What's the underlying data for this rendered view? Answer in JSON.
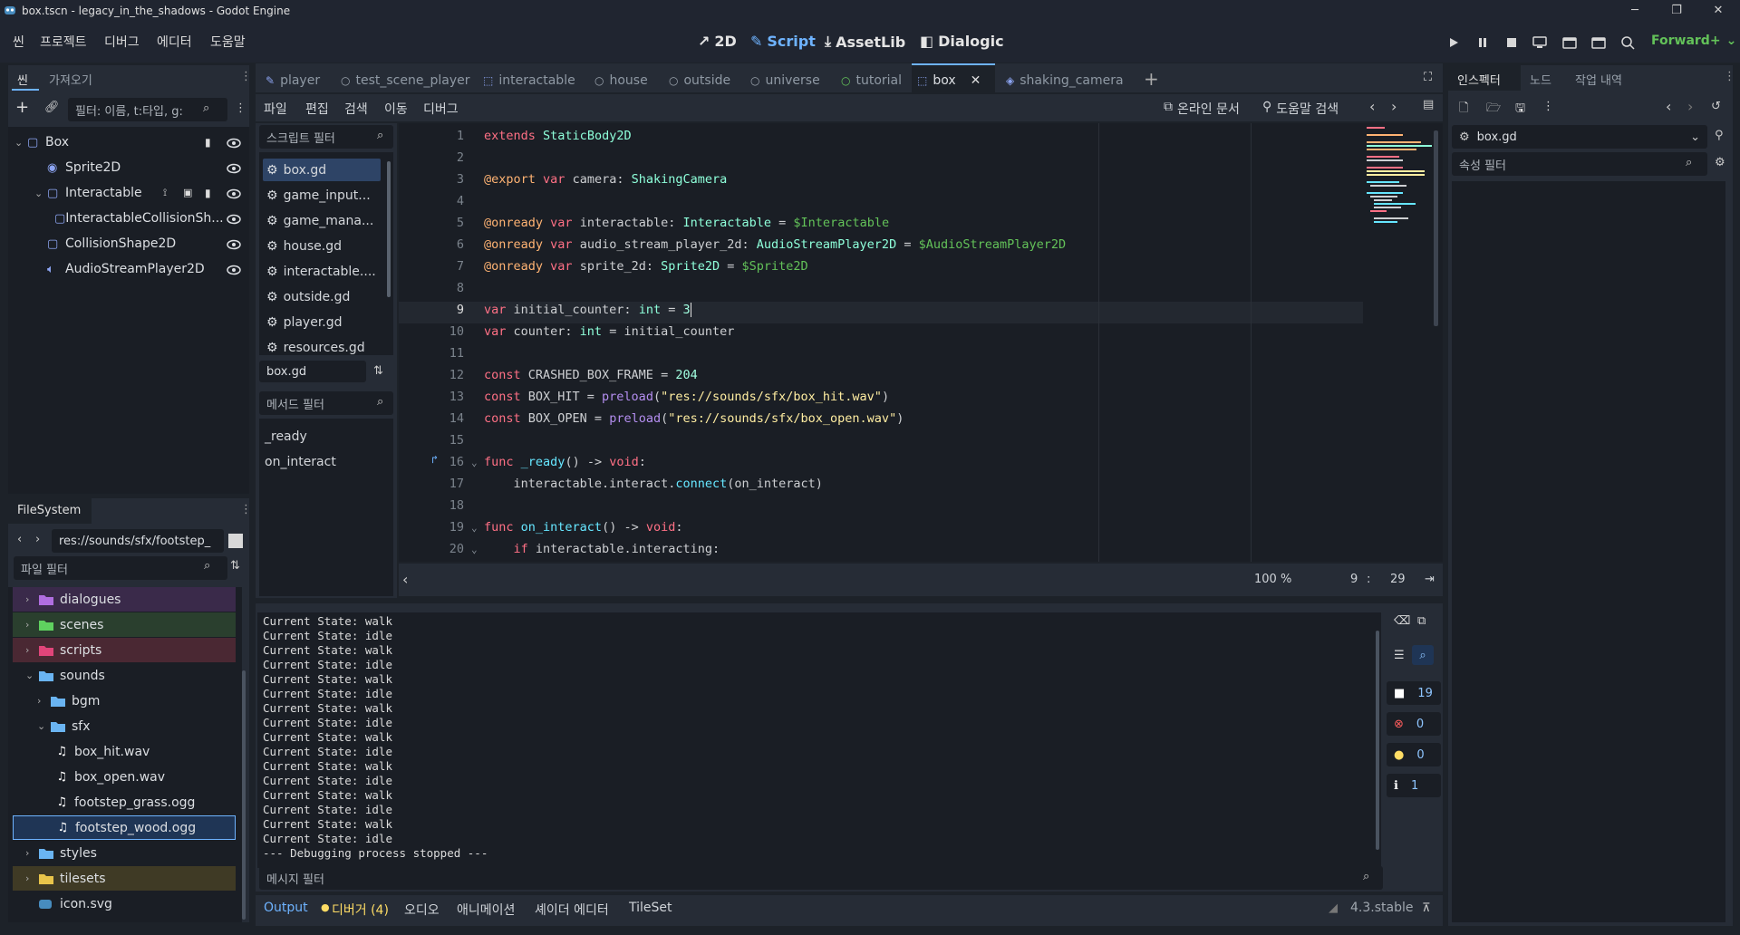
{
  "window": {
    "title": "box.tscn - legacy_in_the_shadows - Godot Engine"
  },
  "menu": [
    "씬",
    "프로젝트",
    "디버그",
    "에디터",
    "도움말"
  ],
  "workspaces": [
    {
      "label": "2D"
    },
    {
      "label": "Script",
      "active": true
    },
    {
      "label": "AssetLib"
    },
    {
      "label": "Dialogic"
    }
  ],
  "renderer": "Forward+",
  "scene_dock": {
    "tabs": [
      "씬",
      "가져오기"
    ],
    "filter_placeholder": "필터: 이름, t:타입, g:",
    "nodes": [
      {
        "name": "Box",
        "depth": 0,
        "icon": "static-body-icon"
      },
      {
        "name": "Sprite2D",
        "depth": 1,
        "icon": "sprite-icon"
      },
      {
        "name": "Interactable",
        "depth": 1,
        "icon": "area-icon"
      },
      {
        "name": "InteractableCollisionSh...",
        "depth": 2,
        "icon": "collision-icon"
      },
      {
        "name": "CollisionShape2D",
        "depth": 1,
        "icon": "collision-icon"
      },
      {
        "name": "AudioStreamPlayer2D",
        "depth": 1,
        "icon": "audio-icon"
      }
    ]
  },
  "filesystem": {
    "tab": "FileSystem",
    "path": "res://sounds/sfx/footstep_",
    "filter_placeholder": "파일 필터",
    "items": [
      {
        "name": "dialogues",
        "depth": 0,
        "type": "folder",
        "color": "#b06ee0",
        "bg": "#3a2a4a"
      },
      {
        "name": "scenes",
        "depth": 0,
        "type": "folder",
        "color": "#5fd15f",
        "bg": "#2a3f2e"
      },
      {
        "name": "scripts",
        "depth": 0,
        "type": "folder",
        "color": "#e0457a",
        "bg": "#4a2833"
      },
      {
        "name": "sounds",
        "depth": 0,
        "type": "folder",
        "color": "#6ab4f2",
        "bg": ""
      },
      {
        "name": "bgm",
        "depth": 1,
        "type": "folder",
        "color": "#6ab4f2",
        "bg": ""
      },
      {
        "name": "sfx",
        "depth": 1,
        "type": "folder",
        "color": "#6ab4f2",
        "bg": ""
      },
      {
        "name": "box_hit.wav",
        "depth": 2,
        "type": "audio",
        "bg": ""
      },
      {
        "name": "box_open.wav",
        "depth": 2,
        "type": "audio",
        "bg": ""
      },
      {
        "name": "footstep_grass.ogg",
        "depth": 2,
        "type": "audio",
        "bg": ""
      },
      {
        "name": "footstep_wood.ogg",
        "depth": 2,
        "type": "audio",
        "bg": "#1f3555",
        "selected": true
      },
      {
        "name": "styles",
        "depth": 0,
        "type": "folder",
        "color": "#6ab4f2",
        "bg": ""
      },
      {
        "name": "tilesets",
        "depth": 0,
        "type": "folder",
        "color": "#e8c44a",
        "bg": "#3f3a25"
      },
      {
        "name": "icon.svg",
        "depth": 0,
        "type": "image",
        "bg": ""
      }
    ]
  },
  "editor_tabs": [
    {
      "label": "player",
      "icon": "script-icon"
    },
    {
      "label": "test_scene_player",
      "icon": "node-icon"
    },
    {
      "label": "interactable",
      "icon": "area-icon"
    },
    {
      "label": "house",
      "icon": "node-icon"
    },
    {
      "label": "outside",
      "icon": "node-icon"
    },
    {
      "label": "universe",
      "icon": "node-icon"
    },
    {
      "label": "tutorial",
      "icon": "node-icon"
    },
    {
      "label": "box",
      "icon": "static-body-icon",
      "active": true
    },
    {
      "label": "shaking_camera",
      "icon": "camera-icon"
    }
  ],
  "script_menu": [
    "파일",
    "편집",
    "검색",
    "이동",
    "디버그"
  ],
  "online_docs": "온라인 문서",
  "help_search": "도움말 검색",
  "script_filter": "스크립트 필터",
  "scripts": [
    "box.gd",
    "game_input...",
    "game_mana...",
    "house.gd",
    "interactable....",
    "outside.gd",
    "player.gd",
    "resources.gd"
  ],
  "current_script": "box.gd",
  "method_filter": "메서드 필터",
  "methods": [
    "_ready",
    "on_interact"
  ],
  "code": [
    [
      [
        "kw",
        "extends"
      ],
      [
        "tx",
        " "
      ],
      [
        "ty",
        "StaticBody2D"
      ]
    ],
    [],
    [
      [
        "an",
        "@export"
      ],
      [
        "tx",
        " "
      ],
      [
        "kw",
        "var"
      ],
      [
        "tx",
        " camera: "
      ],
      [
        "ty",
        "ShakingCamera"
      ]
    ],
    [],
    [
      [
        "an",
        "@onready"
      ],
      [
        "tx",
        " "
      ],
      [
        "kw",
        "var"
      ],
      [
        "tx",
        " interactable: "
      ],
      [
        "ty",
        "Interactable"
      ],
      [
        "tx",
        " = "
      ],
      [
        "np",
        "$Interactable"
      ]
    ],
    [
      [
        "an",
        "@onready"
      ],
      [
        "tx",
        " "
      ],
      [
        "kw",
        "var"
      ],
      [
        "tx",
        " audio_stream_player_2d: "
      ],
      [
        "ty",
        "AudioStreamPlayer2D"
      ],
      [
        "tx",
        " = "
      ],
      [
        "np",
        "$AudioStreamPlayer2D"
      ]
    ],
    [
      [
        "an",
        "@onready"
      ],
      [
        "tx",
        " "
      ],
      [
        "kw",
        "var"
      ],
      [
        "tx",
        " sprite_2d: "
      ],
      [
        "ty",
        "Sprite2D"
      ],
      [
        "tx",
        " = "
      ],
      [
        "np",
        "$Sprite2D"
      ]
    ],
    [],
    [
      [
        "kw",
        "var"
      ],
      [
        "tx",
        " initial_counter: "
      ],
      [
        "ty",
        "int"
      ],
      [
        "tx",
        " = "
      ],
      [
        "nm",
        "3"
      ]
    ],
    [
      [
        "kw",
        "var"
      ],
      [
        "tx",
        " counter: "
      ],
      [
        "ty",
        "int"
      ],
      [
        "tx",
        " = initial_counter"
      ]
    ],
    [],
    [
      [
        "kw",
        "const"
      ],
      [
        "tx",
        " CRASHED_BOX_FRAME = "
      ],
      [
        "nm",
        "204"
      ]
    ],
    [
      [
        "kw",
        "const"
      ],
      [
        "tx",
        " BOX_HIT = "
      ],
      [
        "kw2",
        "preload"
      ],
      [
        "tx",
        "("
      ],
      [
        "st",
        "\"res://sounds/sfx/box_hit.wav\""
      ],
      [
        "tx",
        ")"
      ]
    ],
    [
      [
        "kw",
        "const"
      ],
      [
        "tx",
        " BOX_OPEN = "
      ],
      [
        "kw2",
        "preload"
      ],
      [
        "tx",
        "("
      ],
      [
        "st",
        "\"res://sounds/sfx/box_open.wav\""
      ],
      [
        "tx",
        ")"
      ]
    ],
    [],
    [
      [
        "kw",
        "func"
      ],
      [
        "tx",
        " "
      ],
      [
        "fn",
        "_ready"
      ],
      [
        "tx",
        "() -> "
      ],
      [
        "kw",
        "void"
      ],
      [
        "tx",
        ":"
      ]
    ],
    [
      [
        "tx",
        "    interactable.interact."
      ],
      [
        "fn",
        "connect"
      ],
      [
        "tx",
        "(on_interact)"
      ]
    ],
    [],
    [
      [
        "kw",
        "func"
      ],
      [
        "tx",
        " "
      ],
      [
        "fn",
        "on_interact"
      ],
      [
        "tx",
        "() -> "
      ],
      [
        "kw",
        "void"
      ],
      [
        "tx",
        ":"
      ]
    ],
    [
      [
        "tx",
        "    "
      ],
      [
        "kw",
        "if"
      ],
      [
        "tx",
        " interactable.interacting:"
      ]
    ]
  ],
  "current_line": 9,
  "zoom": "100 %",
  "cursor_line": "9",
  "cursor_col": "29",
  "output_lines": [
    "Current State: walk",
    "Current State: idle",
    "Current State: walk",
    "Current State: idle",
    "Current State: walk",
    "Current State: idle",
    "Current State: walk",
    "Current State: idle",
    "Current State: walk",
    "Current State: idle",
    "Current State: walk",
    "Current State: idle",
    "Current State: walk",
    "Current State: idle",
    "Current State: walk",
    "Current State: idle",
    "--- Debugging process stopped ---"
  ],
  "message_filter": "메시지 필터",
  "counts": {
    "log": "19",
    "errors": "0",
    "warnings": "0",
    "info": "1"
  },
  "bottom_tabs": [
    "Output",
    "디버거 (4)",
    "오디오",
    "애니메이션",
    "셰이더 에디터",
    "TileSet"
  ],
  "version": "4.3.stable",
  "inspector": {
    "tabs": [
      "인스펙터",
      "노드",
      "작업 내역"
    ],
    "resource": "box.gd",
    "filter": "속성 필터"
  },
  "colors": {
    "accent": "#6eb3ff",
    "bg": "#1d2229",
    "panel": "#262c36",
    "field": "#1a1e25"
  }
}
